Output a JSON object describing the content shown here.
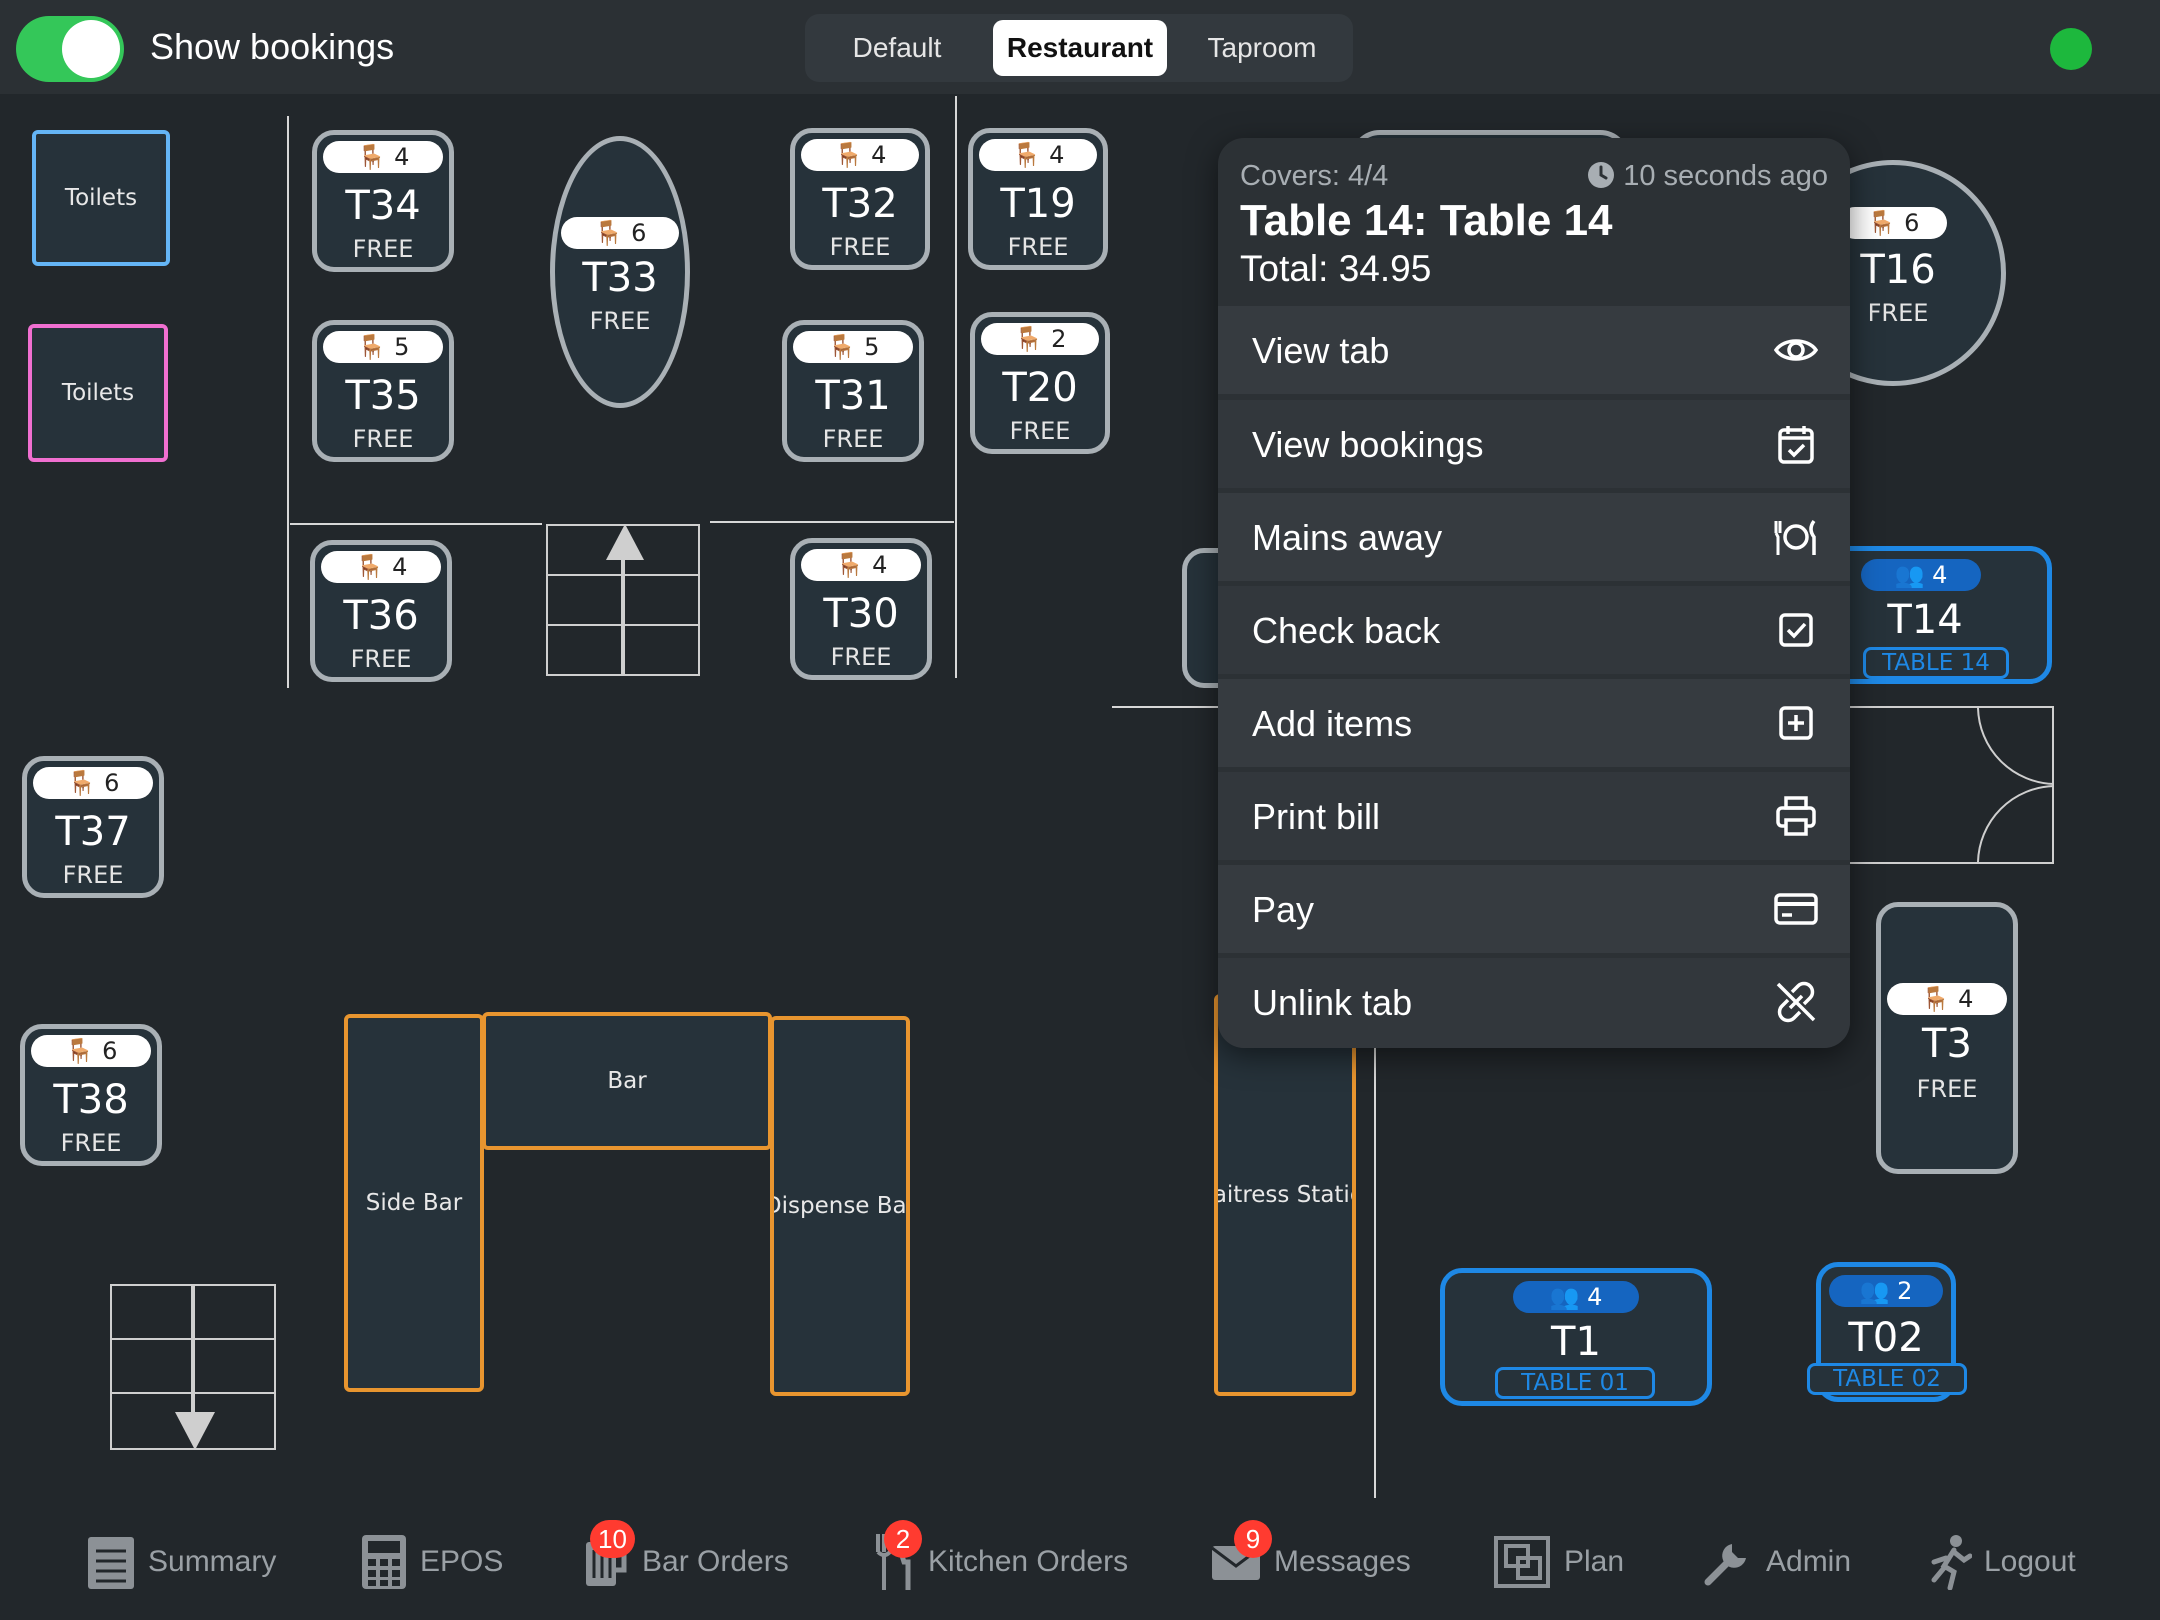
{
  "topbar": {
    "toggle_label": "Show bookings",
    "toggle_on": true,
    "layouts": [
      "Default",
      "Restaurant",
      "Taproom"
    ],
    "active_layout": "Restaurant",
    "status_color": "#1db83d"
  },
  "rooms": {
    "toilets_1": "Toilets",
    "toilets_2": "Toilets",
    "side_bar": "Side Bar",
    "bar": "Bar",
    "dispense_bar": "Dispense Bar",
    "waitress_station": "Waitress Station"
  },
  "tables": {
    "T34": {
      "name": "T34",
      "seats": "4",
      "status": "FREE"
    },
    "T33": {
      "name": "T33",
      "seats": "6",
      "status": "FREE"
    },
    "T32": {
      "name": "T32",
      "seats": "4",
      "status": "FREE"
    },
    "T19": {
      "name": "T19",
      "seats": "4",
      "status": "FREE"
    },
    "T35": {
      "name": "T35",
      "seats": "5",
      "status": "FREE"
    },
    "T31": {
      "name": "T31",
      "seats": "5",
      "status": "FREE"
    },
    "T20": {
      "name": "T20",
      "seats": "2",
      "status": "FREE"
    },
    "T36": {
      "name": "T36",
      "seats": "4",
      "status": "FREE"
    },
    "T30": {
      "name": "T30",
      "seats": "4",
      "status": "FREE"
    },
    "T37": {
      "name": "T37",
      "seats": "6",
      "status": "FREE"
    },
    "T38": {
      "name": "T38",
      "seats": "6",
      "status": "FREE"
    },
    "T16": {
      "name": "T16",
      "seats": "6",
      "status": "FREE"
    },
    "T3": {
      "name": "T3",
      "seats": "4",
      "status": "FREE"
    },
    "T14": {
      "name": "T14",
      "covers": "4",
      "tab": "TABLE 14"
    },
    "T1": {
      "name": "T1",
      "covers": "4",
      "tab": "TABLE 01"
    },
    "T02": {
      "name": "T02",
      "covers": "2",
      "tab": "TABLE 02"
    }
  },
  "popup": {
    "covers": "Covers: 4/4",
    "time_ago": "10 seconds ago",
    "title": "Table 14: Table 14",
    "total": "Total: 34.95",
    "items": [
      "View tab",
      "View bookings",
      "Mains away",
      "Check back",
      "Add items",
      "Print bill",
      "Pay",
      "Unlink tab"
    ]
  },
  "nav": {
    "summary": "Summary",
    "epos": "EPOS",
    "bar_orders": "Bar Orders",
    "bar_orders_count": "10",
    "kitchen_orders": "Kitchen Orders",
    "kitchen_orders_count": "2",
    "messages": "Messages",
    "messages_count": "9",
    "plan": "Plan",
    "admin": "Admin",
    "logout": "Logout"
  }
}
